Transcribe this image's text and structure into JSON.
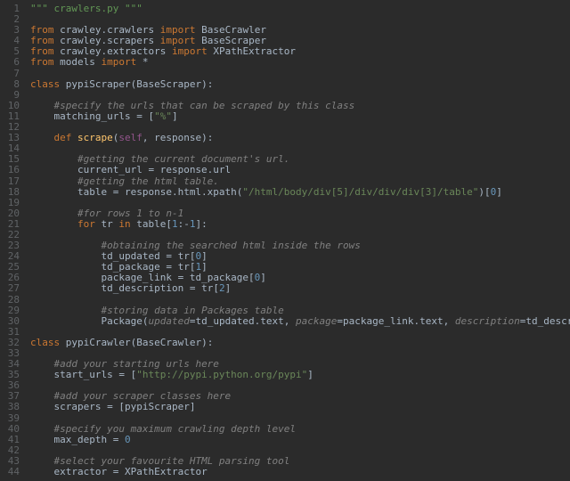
{
  "colors": {
    "background": "#2b2b2b",
    "gutter_text": "#606366",
    "keyword": "#cc7832",
    "string": "#6a8759",
    "number": "#6897bb",
    "comment": "#808080",
    "function": "#ffc66d",
    "self": "#94558d",
    "docstring": "#629755",
    "default": "#a9b7c6"
  },
  "line_numbers": [
    1,
    2,
    3,
    4,
    5,
    6,
    7,
    8,
    9,
    10,
    11,
    12,
    13,
    14,
    15,
    16,
    17,
    18,
    19,
    20,
    21,
    22,
    23,
    24,
    25,
    26,
    27,
    28,
    29,
    30,
    31,
    32,
    33,
    34,
    35,
    36,
    37,
    38,
    39,
    40,
    41,
    42,
    43,
    44
  ],
  "lines": [
    {
      "tokens": [
        {
          "t": "docstr",
          "v": "\"\"\" crawlers.py \"\"\""
        }
      ]
    },
    {
      "tokens": []
    },
    {
      "tokens": [
        {
          "t": "kw",
          "v": "from"
        },
        {
          "t": "id",
          "v": " crawley.crawlers "
        },
        {
          "t": "kw",
          "v": "import"
        },
        {
          "t": "id",
          "v": " BaseCrawler"
        }
      ]
    },
    {
      "tokens": [
        {
          "t": "kw",
          "v": "from"
        },
        {
          "t": "id",
          "v": " crawley.scrapers "
        },
        {
          "t": "kw",
          "v": "import"
        },
        {
          "t": "id",
          "v": " BaseScraper"
        }
      ]
    },
    {
      "tokens": [
        {
          "t": "kw",
          "v": "from"
        },
        {
          "t": "id",
          "v": " crawley.extractors "
        },
        {
          "t": "kw",
          "v": "import"
        },
        {
          "t": "id",
          "v": " XPathExtractor"
        }
      ]
    },
    {
      "tokens": [
        {
          "t": "kw",
          "v": "from"
        },
        {
          "t": "id",
          "v": " models "
        },
        {
          "t": "kw",
          "v": "import"
        },
        {
          "t": "id",
          "v": " *"
        }
      ]
    },
    {
      "tokens": []
    },
    {
      "tokens": [
        {
          "t": "kw",
          "v": "class "
        },
        {
          "t": "cls",
          "v": "pypiScraper"
        },
        {
          "t": "id",
          "v": "("
        },
        {
          "t": "id",
          "v": "BaseScraper"
        },
        {
          "t": "id",
          "v": "):"
        }
      ]
    },
    {
      "tokens": []
    },
    {
      "indent": 1,
      "tokens": [
        {
          "t": "cmt",
          "v": "#specify the urls that can be scraped by this class"
        }
      ]
    },
    {
      "indent": 1,
      "tokens": [
        {
          "t": "id",
          "v": "matching_urls = ["
        },
        {
          "t": "str",
          "v": "\"%\""
        },
        {
          "t": "id",
          "v": "]"
        }
      ]
    },
    {
      "tokens": []
    },
    {
      "indent": 1,
      "tokens": [
        {
          "t": "kw",
          "v": "def "
        },
        {
          "t": "fn",
          "v": "scrape"
        },
        {
          "t": "id",
          "v": "("
        },
        {
          "t": "self",
          "v": "self"
        },
        {
          "t": "op",
          "v": ", "
        },
        {
          "t": "id",
          "v": "response"
        },
        {
          "t": "id",
          "v": "):"
        }
      ]
    },
    {
      "tokens": []
    },
    {
      "indent": 2,
      "tokens": [
        {
          "t": "cmt",
          "v": "#getting the current document's url."
        }
      ]
    },
    {
      "indent": 2,
      "tokens": [
        {
          "t": "id",
          "v": "current_url = response.url"
        }
      ]
    },
    {
      "indent": 2,
      "tokens": [
        {
          "t": "cmt",
          "v": "#getting the html table."
        }
      ]
    },
    {
      "indent": 2,
      "tokens": [
        {
          "t": "id",
          "v": "table = response.html.xpath("
        },
        {
          "t": "str",
          "v": "\"/html/body/div[5]/div/div/div[3]/table\""
        },
        {
          "t": "id",
          "v": ")["
        },
        {
          "t": "num",
          "v": "0"
        },
        {
          "t": "id",
          "v": "]"
        }
      ]
    },
    {
      "tokens": []
    },
    {
      "indent": 2,
      "tokens": [
        {
          "t": "cmt",
          "v": "#for rows 1 to n-1"
        }
      ]
    },
    {
      "indent": 2,
      "tokens": [
        {
          "t": "kw",
          "v": "for"
        },
        {
          "t": "id",
          "v": " tr "
        },
        {
          "t": "kw",
          "v": "in"
        },
        {
          "t": "id",
          "v": " table["
        },
        {
          "t": "num",
          "v": "1"
        },
        {
          "t": "id",
          "v": ":"
        },
        {
          "t": "op",
          "v": "-"
        },
        {
          "t": "num",
          "v": "1"
        },
        {
          "t": "id",
          "v": "]:"
        }
      ]
    },
    {
      "tokens": []
    },
    {
      "indent": 3,
      "tokens": [
        {
          "t": "cmt",
          "v": "#obtaining the searched html inside the rows"
        }
      ]
    },
    {
      "indent": 3,
      "tokens": [
        {
          "t": "id",
          "v": "td_updated = tr["
        },
        {
          "t": "num",
          "v": "0"
        },
        {
          "t": "id",
          "v": "]"
        }
      ]
    },
    {
      "indent": 3,
      "tokens": [
        {
          "t": "id",
          "v": "td_package = tr["
        },
        {
          "t": "num",
          "v": "1"
        },
        {
          "t": "id",
          "v": "]"
        }
      ]
    },
    {
      "indent": 3,
      "tokens": [
        {
          "t": "id",
          "v": "package_link = td_package["
        },
        {
          "t": "num",
          "v": "0"
        },
        {
          "t": "id",
          "v": "]"
        }
      ]
    },
    {
      "indent": 3,
      "tokens": [
        {
          "t": "id",
          "v": "td_description = tr["
        },
        {
          "t": "num",
          "v": "2"
        },
        {
          "t": "id",
          "v": "]"
        }
      ]
    },
    {
      "tokens": []
    },
    {
      "indent": 3,
      "tokens": [
        {
          "t": "cmt",
          "v": "#storing data in Packages table"
        }
      ]
    },
    {
      "indent": 3,
      "tokens": [
        {
          "t": "id",
          "v": "Package("
        },
        {
          "t": "kwarg",
          "v": "updated"
        },
        {
          "t": "op",
          "v": "="
        },
        {
          "t": "id",
          "v": "td_updated.text, "
        },
        {
          "t": "kwarg",
          "v": "package"
        },
        {
          "t": "op",
          "v": "="
        },
        {
          "t": "id",
          "v": "package_link.text, "
        },
        {
          "t": "kwarg",
          "v": "description"
        },
        {
          "t": "op",
          "v": "="
        },
        {
          "t": "id",
          "v": "td_description.text)"
        }
      ]
    },
    {
      "tokens": []
    },
    {
      "tokens": [
        {
          "t": "kw",
          "v": "class "
        },
        {
          "t": "cls",
          "v": "pypiCrawler"
        },
        {
          "t": "id",
          "v": "("
        },
        {
          "t": "id",
          "v": "BaseCrawler"
        },
        {
          "t": "id",
          "v": "):"
        }
      ]
    },
    {
      "tokens": []
    },
    {
      "indent": 1,
      "tokens": [
        {
          "t": "cmt",
          "v": "#add your starting urls here"
        }
      ]
    },
    {
      "indent": 1,
      "tokens": [
        {
          "t": "id",
          "v": "start_urls = ["
        },
        {
          "t": "str",
          "v": "\"http://pypi.python.org/pypi\""
        },
        {
          "t": "id",
          "v": "]"
        }
      ]
    },
    {
      "tokens": []
    },
    {
      "indent": 1,
      "tokens": [
        {
          "t": "cmt",
          "v": "#add your scraper classes here"
        }
      ]
    },
    {
      "indent": 1,
      "tokens": [
        {
          "t": "id",
          "v": "scrapers = [pypiScraper]"
        }
      ]
    },
    {
      "tokens": []
    },
    {
      "indent": 1,
      "tokens": [
        {
          "t": "cmt",
          "v": "#specify you maximum crawling depth level"
        }
      ]
    },
    {
      "indent": 1,
      "tokens": [
        {
          "t": "id",
          "v": "max_depth = "
        },
        {
          "t": "num",
          "v": "0"
        }
      ]
    },
    {
      "tokens": []
    },
    {
      "indent": 1,
      "tokens": [
        {
          "t": "cmt",
          "v": "#select your favourite HTML parsing tool"
        }
      ]
    },
    {
      "indent": 1,
      "tokens": [
        {
          "t": "id",
          "v": "extractor = XPathExtractor"
        }
      ]
    }
  ]
}
